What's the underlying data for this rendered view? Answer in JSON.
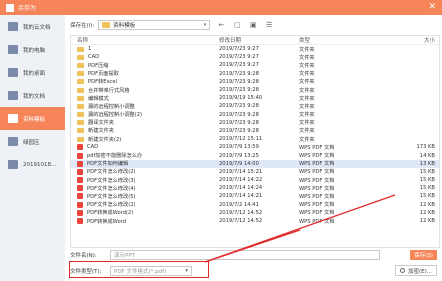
{
  "window": {
    "title": "另存为",
    "close_glyph": "✕"
  },
  "sidebar": {
    "items": [
      {
        "label": "我的云文档",
        "active": false
      },
      {
        "label": "我的电脑",
        "active": false
      },
      {
        "label": "我的桌面",
        "active": false
      },
      {
        "label": "我的文档",
        "active": false
      },
      {
        "label": "资料模板",
        "active": true
      },
      {
        "label": "绿园区",
        "active": false
      },
      {
        "label": "20191018...",
        "active": false
      }
    ]
  },
  "toolbar": {
    "location_label": "保存在(I):",
    "location_value": "资料模板",
    "dropdown_glyph": "▾",
    "buttons": [
      {
        "icon": "back-arrow-icon",
        "glyph": "←"
      },
      {
        "icon": "up-folder-icon",
        "glyph": "▢"
      },
      {
        "icon": "new-folder-icon",
        "glyph": "▣"
      },
      {
        "icon": "view-menu-icon",
        "glyph": "☰"
      }
    ]
  },
  "filelist": {
    "columns": [
      "名称",
      "修改日期",
      "类型",
      "大小"
    ],
    "rows": [
      {
        "name": "1",
        "date": "2019/7/23 9:27",
        "type": "文件夹",
        "size": "",
        "kind": "folder"
      },
      {
        "name": "CAD",
        "date": "2019/7/23 9:27",
        "type": "文件夹",
        "size": "",
        "kind": "folder"
      },
      {
        "name": "PDF压缩",
        "date": "2019/7/23 9:27",
        "type": "文件夹",
        "size": "",
        "kind": "folder"
      },
      {
        "name": "PDF页面提取",
        "date": "2019/7/23 9:28",
        "type": "文件夹",
        "size": "",
        "kind": "folder"
      },
      {
        "name": "PDF转Excel",
        "date": "2019/7/23 9:28",
        "type": "文件夹",
        "size": "",
        "kind": "folder"
      },
      {
        "name": "合并带单行式风格",
        "date": "2019/7/23 9:28",
        "type": "文件夹",
        "size": "",
        "kind": "folder"
      },
      {
        "name": "编辑模式",
        "date": "2019/9/19 15:40",
        "type": "文件夹",
        "size": "",
        "kind": "folder"
      },
      {
        "name": "漏的远程控制小调整",
        "date": "2019/7/23 9:28",
        "type": "文件夹",
        "size": "",
        "kind": "folder"
      },
      {
        "name": "漏的远程控制小调整(2)",
        "date": "2019/7/23 9:28",
        "type": "文件夹",
        "size": "",
        "kind": "folder"
      },
      {
        "name": "翻译文件夹",
        "date": "2019/7/23 9:28",
        "type": "文件夹",
        "size": "",
        "kind": "folder"
      },
      {
        "name": "新建文件夹",
        "date": "2019/7/23 9:28",
        "type": "文件夹",
        "size": "",
        "kind": "folder"
      },
      {
        "name": "新建文件夹(2)",
        "date": "2019/7/12 15:11",
        "type": "文件夹",
        "size": "",
        "kind": "folder"
      },
      {
        "name": "CAD",
        "date": "2019/7/9 13:59",
        "type": "WPS PDF 文档",
        "size": "173 KB",
        "kind": "pdf"
      },
      {
        "name": "pdf加密不能删除怎么办",
        "date": "2019/7/9 13:25",
        "type": "WPS PDF 文档",
        "size": "14 KB",
        "kind": "pdf"
      },
      {
        "name": "PDF文件如何编辑",
        "date": "2019/7/9 14:00",
        "type": "WPS PDF 文档",
        "size": "13 KB",
        "kind": "pdf",
        "selected": true
      },
      {
        "name": "PDF文件怎么修改(2)",
        "date": "2019/7/14 15:21",
        "type": "WPS PDF 文档",
        "size": "15 KB",
        "kind": "pdf"
      },
      {
        "name": "PDF文件怎么修改(3)",
        "date": "2019/7/14 14:22",
        "type": "WPS PDF 文档",
        "size": "15 KB",
        "kind": "pdf"
      },
      {
        "name": "PDF文件怎么修改(4)",
        "date": "2019/7/14 14:24",
        "type": "WPS PDF 文档",
        "size": "15 KB",
        "kind": "pdf"
      },
      {
        "name": "PDF文件怎么修改(5)",
        "date": "2019/7/14 14:21",
        "type": "WPS PDF 文档",
        "size": "15 KB",
        "kind": "pdf"
      },
      {
        "name": "PDF文件怎么修改(2)",
        "date": "2019/7/2 14:41",
        "type": "WPS PDF 文档",
        "size": "12 KB",
        "kind": "pdf"
      },
      {
        "name": "PDF转换成Word(2)",
        "date": "2019/7/12 14:52",
        "type": "WPS PDF 文档",
        "size": "12 KB",
        "kind": "pdf"
      },
      {
        "name": "PDF转换成Word",
        "date": "2019/7/12 14:52",
        "type": "WPS PDF 文档",
        "size": "12 KB",
        "kind": "pdf"
      }
    ]
  },
  "bottom": {
    "filename_label": "文件名(N):",
    "filename_value": "演示PPT",
    "filetype_label": "文件类型(T):",
    "filetype_value": "PDF 文件格式(*.pdf)",
    "save_label": "保存(S)",
    "encrypt_label": "加密(E)..."
  },
  "colors": {
    "accent": "#f7855a",
    "annotation": "#e02a2a",
    "folder": "#f0c35a",
    "pdf": "#e8453c"
  }
}
